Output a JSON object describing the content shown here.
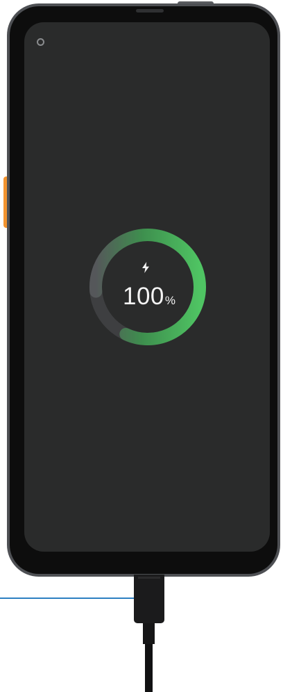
{
  "charging": {
    "percent_value": "100",
    "percent_unit": "%",
    "level": 1.0,
    "ring_color_start": "#7a7c7e",
    "ring_color_end": "#4fc463",
    "track_color": "#3e3f41"
  },
  "icons": {
    "status": "bolt-icon",
    "camera": "camera-icon"
  },
  "colors": {
    "screen": "#2a2b2b",
    "frame": "#4e5054",
    "side_key": "#f2932f",
    "callout": "#2c7fc1"
  }
}
